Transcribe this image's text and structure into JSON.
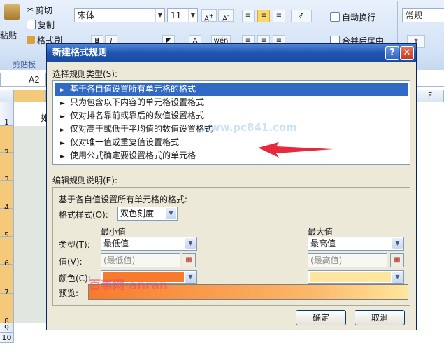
{
  "ribbon": {
    "clipboard": {
      "paste": "粘贴",
      "cut": "剪切",
      "copy": "复制",
      "format_painter": "格式刷",
      "group_label": "剪贴板"
    },
    "font": {
      "name": "宋体",
      "size": "11"
    },
    "alignment": {
      "wrap_text": "自动换行",
      "merge_center": "合并后居中"
    },
    "number": {
      "format": "常规"
    }
  },
  "sheet": {
    "name_box": "A2",
    "column_f": "F",
    "rows": [
      "1",
      "2",
      "3",
      "4",
      "5",
      "6",
      "7",
      "8",
      "9",
      "10"
    ],
    "cell_a1_partial": "如"
  },
  "dialog": {
    "title": "新建格式规则",
    "help": "?",
    "close": "✕",
    "rule_type_label": "选择规则类型(S):",
    "rule_types": [
      "基于各自值设置所有单元格的格式",
      "只为包含以下内容的单元格设置格式",
      "仅对排名靠前或靠后的数值设置格式",
      "仅对高于或低于平均值的数值设置格式",
      "仅对唯一值或重复值设置格式",
      "使用公式确定要设置格式的单元格"
    ],
    "selected_index": 0,
    "edit_label": "编辑规则说明(E):",
    "edit_heading": "基于各自值设置所有单元格的格式:",
    "format_style_label": "格式样式(O):",
    "format_style_value": "双色刻度",
    "min_header": "最小值",
    "max_header": "最大值",
    "type_label": "类型(T):",
    "value_label": "值(V):",
    "color_label": "颜色(C):",
    "min_type": "最低值",
    "max_type": "最高值",
    "min_value": "(最低值)",
    "max_value": "(最高值)",
    "min_color": "#f87a2b",
    "max_color": "#ffe69e",
    "preview_label": "预览:",
    "ok": "确定",
    "cancel": "取消"
  },
  "watermarks": {
    "a": "www.pc841.com",
    "b": "百事网·anran"
  },
  "icons": [
    "paste-icon",
    "scissors-icon",
    "copy-icon",
    "format-painter-icon",
    "wrap-text-icon",
    "merge-icon",
    "range-picker-icon",
    "arrow-icon"
  ]
}
